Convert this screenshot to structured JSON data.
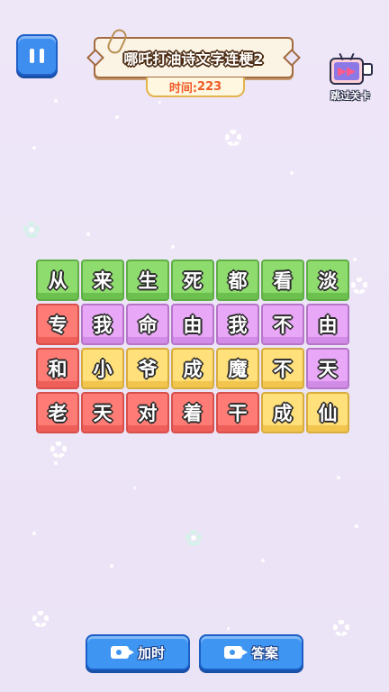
{
  "header": {
    "title": "哪吒打油诗文字连梗2",
    "timer_label": "时间:",
    "timer_value": "223",
    "skip_label": "跳过关卡"
  },
  "grid": {
    "rows": [
      [
        {
          "char": "从",
          "color": "green"
        },
        {
          "char": "来",
          "color": "green"
        },
        {
          "char": "生",
          "color": "green"
        },
        {
          "char": "死",
          "color": "green"
        },
        {
          "char": "都",
          "color": "green"
        },
        {
          "char": "看",
          "color": "green"
        },
        {
          "char": "淡",
          "color": "green"
        }
      ],
      [
        {
          "char": "专",
          "color": "red"
        },
        {
          "char": "我",
          "color": "purple"
        },
        {
          "char": "命",
          "color": "purple"
        },
        {
          "char": "由",
          "color": "purple"
        },
        {
          "char": "我",
          "color": "purple"
        },
        {
          "char": "不",
          "color": "purple"
        },
        {
          "char": "由",
          "color": "purple"
        }
      ],
      [
        {
          "char": "和",
          "color": "red"
        },
        {
          "char": "小",
          "color": "yellow"
        },
        {
          "char": "爷",
          "color": "yellow"
        },
        {
          "char": "成",
          "color": "yellow"
        },
        {
          "char": "魔",
          "color": "yellow"
        },
        {
          "char": "不",
          "color": "yellow"
        },
        {
          "char": "天",
          "color": "purple"
        }
      ],
      [
        {
          "char": "老",
          "color": "red"
        },
        {
          "char": "天",
          "color": "red"
        },
        {
          "char": "对",
          "color": "red"
        },
        {
          "char": "着",
          "color": "red"
        },
        {
          "char": "干",
          "color": "red"
        },
        {
          "char": "成",
          "color": "yellow"
        },
        {
          "char": "仙",
          "color": "yellow"
        }
      ]
    ]
  },
  "footer": {
    "add_time_label": "加时",
    "answer_label": "答案"
  },
  "colors": {
    "accent_blue": "#3f96f2",
    "timer_text": "#f05a28",
    "tile_green": "#8fdc6e",
    "tile_red": "#ff7c76",
    "tile_purple": "#e8a8f7",
    "tile_yellow": "#ffe07a"
  },
  "icons": {
    "pause": "pause-icon",
    "skip": "tv-skip-icon",
    "video": "video-camera-icon"
  }
}
